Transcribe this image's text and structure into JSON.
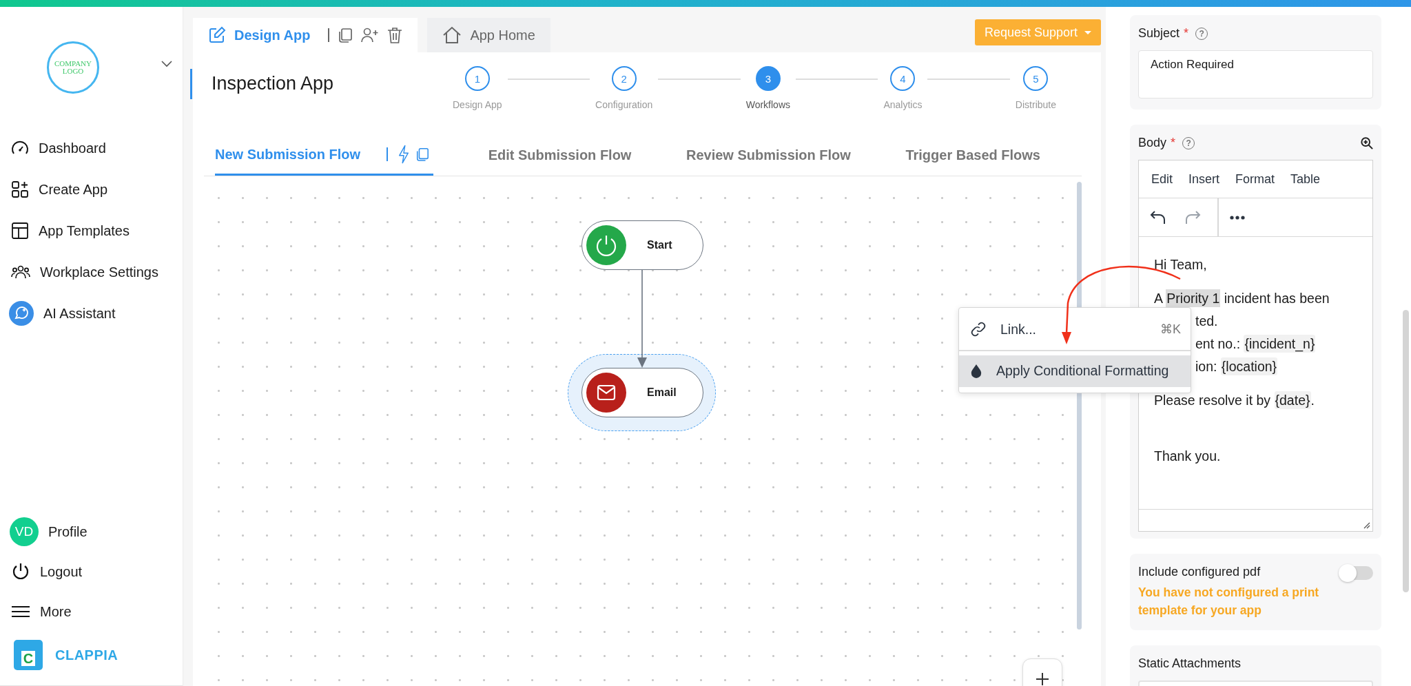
{
  "sidebar": {
    "logo_text": "COMPANY LOGO",
    "nav_items": [
      {
        "label": "Dashboard"
      },
      {
        "label": "Create App"
      },
      {
        "label": "App Templates"
      },
      {
        "label": "Workplace Settings"
      },
      {
        "label": "AI Assistant"
      }
    ],
    "footer_items": [
      {
        "label": "Profile",
        "avatar": "VD"
      },
      {
        "label": "Logout"
      },
      {
        "label": "More"
      }
    ],
    "brand": {
      "mark": "C",
      "name": "CLAPPIA"
    }
  },
  "header": {
    "tabs": [
      {
        "label": "Design App",
        "selected": true
      },
      {
        "label": "App Home",
        "selected": false
      }
    ],
    "support_button": "Request Support"
  },
  "app_title": "Inspection App",
  "steps": [
    {
      "number": "1",
      "label": "Design App",
      "selected": false
    },
    {
      "number": "2",
      "label": "Configuration",
      "selected": false
    },
    {
      "number": "3",
      "label": "Workflows",
      "selected": true
    },
    {
      "number": "4",
      "label": "Analytics",
      "selected": false
    },
    {
      "number": "5",
      "label": "Distribute",
      "selected": false
    }
  ],
  "flow_tabs": [
    {
      "label": "New Submission Flow",
      "selected": true
    },
    {
      "label": "Edit Submission Flow",
      "selected": false
    },
    {
      "label": "Review Submission Flow",
      "selected": false
    },
    {
      "label": "Trigger Based Flows",
      "selected": false
    }
  ],
  "canvas": {
    "nodes": [
      {
        "kind": "start",
        "label": "Start",
        "selected": false
      },
      {
        "kind": "email",
        "label": "Email",
        "selected": true
      }
    ]
  },
  "context_menu": {
    "items": [
      {
        "label": "Link...",
        "shortcut": "⌘K",
        "selected": false
      },
      {
        "label": "Apply Conditional Formatting",
        "selected": true
      }
    ]
  },
  "email_form": {
    "subject": {
      "label": "Subject",
      "required_mark": "*",
      "help": "?",
      "value": "Action Required"
    },
    "body": {
      "label": "Body",
      "required_mark": "*",
      "help": "?",
      "menu": [
        "Edit",
        "Insert",
        "Format",
        "Table"
      ],
      "toolbar": [
        {
          "kind": "undo",
          "disabled": false
        },
        {
          "kind": "redo",
          "disabled": true
        },
        {
          "kind": "more",
          "disabled": false
        }
      ],
      "lines": [
        {
          "kind": "first",
          "segments": [
            {
              "kind": "plain",
              "text": "Hi Team,"
            }
          ]
        },
        {
          "kind": "new_paragraph",
          "segments": [
            {
              "kind": "plain",
              "text": "A "
            },
            {
              "kind": "selected",
              "text": "Priority 1"
            },
            {
              "kind": "plain",
              "text": " incident has been"
            }
          ]
        },
        {
          "kind": "covered",
          "segments": [
            {
              "kind": "plain",
              "text": "ted."
            }
          ]
        },
        {
          "kind": "covered",
          "segments": [
            {
              "kind": "plain",
              "text": "ent no.: "
            },
            {
              "kind": "token",
              "text": "{incident_n}"
            }
          ]
        },
        {
          "kind": "covered",
          "segments": [
            {
              "kind": "plain",
              "text": "ion: "
            },
            {
              "kind": "token",
              "text": "{location}"
            }
          ]
        },
        {
          "kind": "new_paragraph",
          "segments": [
            {
              "kind": "plain",
              "text": "Please resolve it by "
            },
            {
              "kind": "token",
              "text": "{date}"
            },
            {
              "kind": "plain",
              "text": "."
            }
          ]
        },
        {
          "kind": "closing",
          "segments": [
            {
              "kind": "plain",
              "text": "Thank you."
            }
          ]
        }
      ]
    },
    "include_pdf": {
      "label": "Include configured pdf",
      "on": false,
      "warning": "You have not configured a print template for your app"
    },
    "static_attachments": {
      "label": "Static Attachments"
    }
  }
}
